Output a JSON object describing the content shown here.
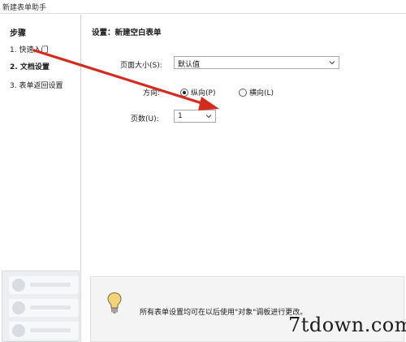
{
  "window": {
    "title": "新建表单助手"
  },
  "sidebar": {
    "heading": "步骤",
    "items": [
      {
        "label": "1. 快速入门"
      },
      {
        "label": "2. 文档设置"
      },
      {
        "label": "3. 表单返回设置"
      }
    ]
  },
  "main": {
    "section_title": "设置：新建空白表单",
    "page_size": {
      "label": "页面大小(S):",
      "value": "默认值"
    },
    "orientation": {
      "label": "方向:",
      "portrait": "纵向(P)",
      "landscape": "横向(L)",
      "selected": "portrait"
    },
    "pages": {
      "label": "页数(U):",
      "value": "1"
    },
    "info_text": "所有表单设置均可在以后使用\"对象\"调板进行更改。"
  },
  "watermark": "7tdown.com",
  "colors": {
    "arrow": "#d42a20",
    "bulb": "#f3d27a"
  },
  "icons": [
    "chevron-down-icon",
    "lightbulb-icon",
    "annotation-arrow"
  ]
}
